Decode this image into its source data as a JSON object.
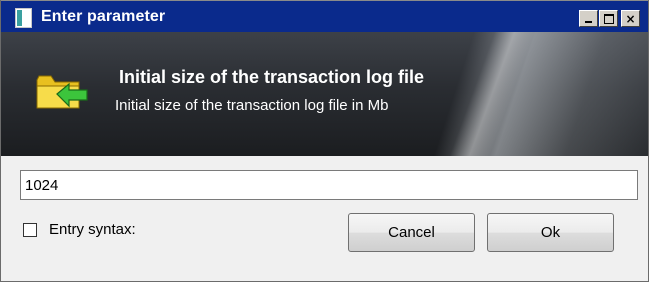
{
  "window": {
    "title": "Enter parameter",
    "controls": {
      "minimize": "minimize",
      "maximize": "maximize",
      "close": "×"
    }
  },
  "banner": {
    "title": "Initial size of the transaction log file",
    "subtitle": "Initial size of the transaction log file in Mb",
    "icon": "folder-arrow-icon"
  },
  "input": {
    "value": "1024"
  },
  "checkbox": {
    "label": "Entry syntax:",
    "checked": false
  },
  "buttons": {
    "cancel": "Cancel",
    "ok": "Ok"
  },
  "colors": {
    "titlebar": "#0a2a8c",
    "banner_dark": "#1b1d20",
    "dialog_bg": "#f0f0f0"
  }
}
